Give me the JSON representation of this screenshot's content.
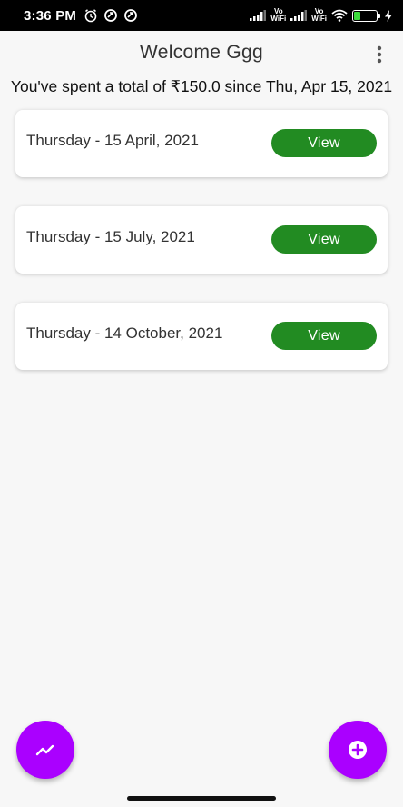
{
  "status_bar": {
    "time": "3:36 PM",
    "left_icons": [
      "alarm-icon",
      "sync-icon",
      "sync-icon"
    ],
    "right_icons": [
      "signal-icon",
      "vowifi-icon",
      "signal-icon",
      "vowifi-icon",
      "wifi-icon",
      "battery-icon",
      "charging-icon"
    ],
    "vowifi_top": "Vo",
    "vowifi_bottom": "WiFi",
    "battery_level": "29",
    "battery_fraction": 0.29
  },
  "header": {
    "title": "Welcome Ggg",
    "menu_icon": "more-vert-icon"
  },
  "summary": {
    "text": "You've spent a total of ₹150.0 since Thu, Apr 15, 2021"
  },
  "entries": [
    {
      "date": "Thursday - 15 April, 2021",
      "action": "View"
    },
    {
      "date": "Thursday - 15 July, 2021",
      "action": "View"
    },
    {
      "date": "Thursday - 14 October, 2021",
      "action": "View"
    }
  ],
  "fabs": {
    "left_icon": "trending-up-icon",
    "right_icon": "add-circle-icon"
  },
  "colors": {
    "accent": "#aa00ff",
    "view_button": "#228b22",
    "background": "#f7f7f7",
    "battery": "#3ddc3d"
  }
}
